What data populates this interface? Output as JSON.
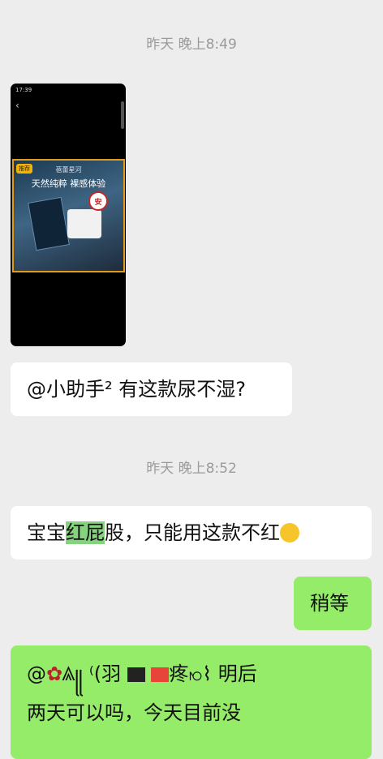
{
  "chat": {
    "timestamp_1": "昨天 晚上8:49",
    "image_message": {
      "status_time": "17:39",
      "back_glyph": "‹",
      "ad_badge": "推荐",
      "ad_brand": "蓓蕾星河",
      "ad_slogan": "天然纯粹 裸感体验",
      "seal_text": "安"
    },
    "message_1_text": "@小助手² 有这款尿不湿?",
    "timestamp_2": "昨天 晚上8:52",
    "message_2_before": "宝宝",
    "message_2_highlight": "红屁",
    "message_2_after": "股，只能用这款不红",
    "message_3_text": "稍等",
    "message_4_line1_prefix": "@",
    "message_4_line1_mid": "ꥃ꧋ ⁽(羽",
    "message_4_line1_tail": "疼ꩯ⌇ 明后",
    "message_4_line2": "两天可以吗，今天目前没"
  },
  "colors": {
    "background": "#ededed",
    "incoming_bubble": "#ffffff",
    "outgoing_bubble": "#95ec69",
    "timestamp_text": "#9b9b9b",
    "highlight": "#86d37f"
  },
  "icons": {
    "emoji": "crying-laughing-emoji",
    "avatar_glyph": "rose-glyph"
  }
}
